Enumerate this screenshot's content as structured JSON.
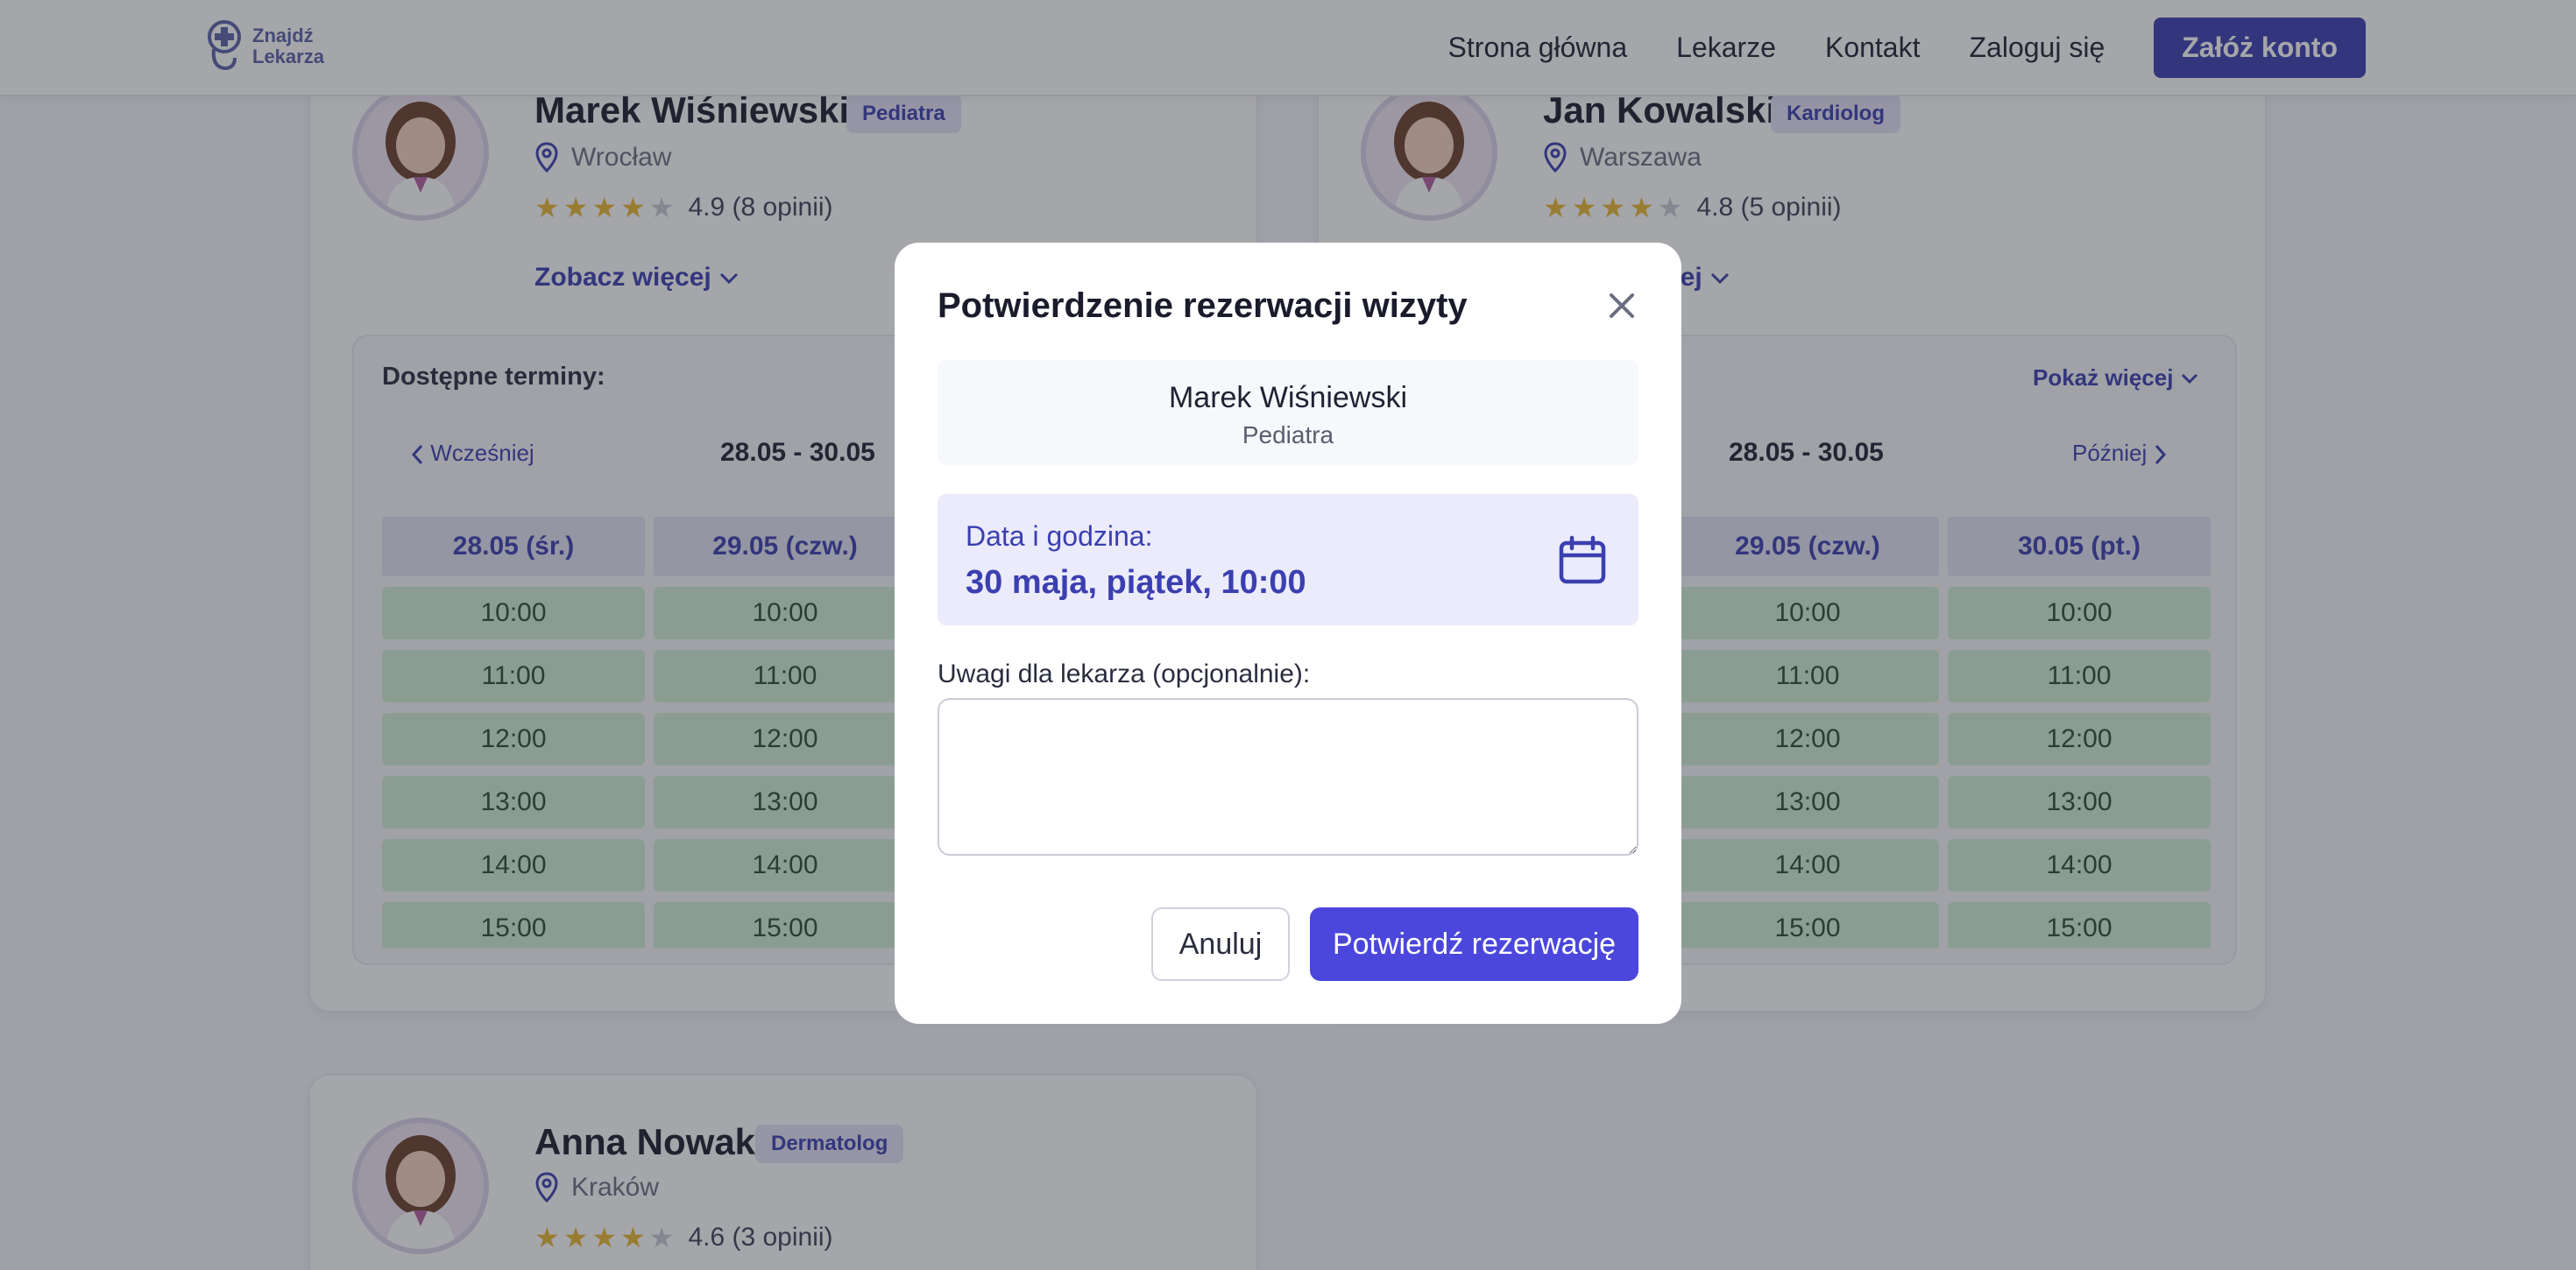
{
  "header": {
    "logo_line1": "Znajdź",
    "logo_line2": "Lekarza",
    "nav": [
      "Strona główna",
      "Lekarze",
      "Kontakt",
      "Zaloguj się"
    ],
    "cta": "Załóż konto"
  },
  "doctors": [
    {
      "name": "Marek Wiśniewski",
      "specialty": "Pediatra",
      "city": "Wrocław",
      "rating": "4.9 (8 opinii)",
      "stars": 4,
      "more": "Zobacz więcej",
      "slots_title": "Dostępne terminy:",
      "prev": "Wcześniej",
      "range": "28.05 - 30.05",
      "days": [
        "28.05 (śr.)",
        "29.05 (czw.)"
      ],
      "times": [
        "10:00",
        "11:00",
        "12:00",
        "13:00",
        "14:00",
        "15:00"
      ]
    },
    {
      "name": "Jan Kowalski",
      "specialty": "Kardiolog",
      "city": "Warszawa",
      "rating": "4.8 (5 opinii)",
      "stars": 4,
      "more_partial": "cej",
      "show_more": "Pokaż więcej",
      "range": "28.05 - 30.05",
      "next": "Później",
      "days": [
        "29.05 (czw.)",
        "30.05 (pt.)"
      ],
      "times": [
        "10:00",
        "11:00",
        "12:00",
        "13:00",
        "14:00",
        "15:00"
      ]
    },
    {
      "name": "Anna Nowak",
      "specialty": "Dermatolog",
      "city": "Kraków",
      "rating": "4.6 (3 opinii)",
      "stars": 4
    }
  ],
  "modal": {
    "title": "Potwierdzenie rezerwacji wizyty",
    "doctor_name": "Marek Wiśniewski",
    "doctor_specialty": "Pediatra",
    "date_label": "Data i godzina:",
    "date_value": "30 maja, piątek, 10:00",
    "notes_label": "Uwagi dla lekarza (opcjonalnie):",
    "notes_value": "",
    "cancel": "Anuluj",
    "confirm": "Potwierdź rezerwację"
  },
  "colors": {
    "accent": "#3b3fb0",
    "confirm": "#4b47dc",
    "slot_bg": "#d3efd6"
  }
}
